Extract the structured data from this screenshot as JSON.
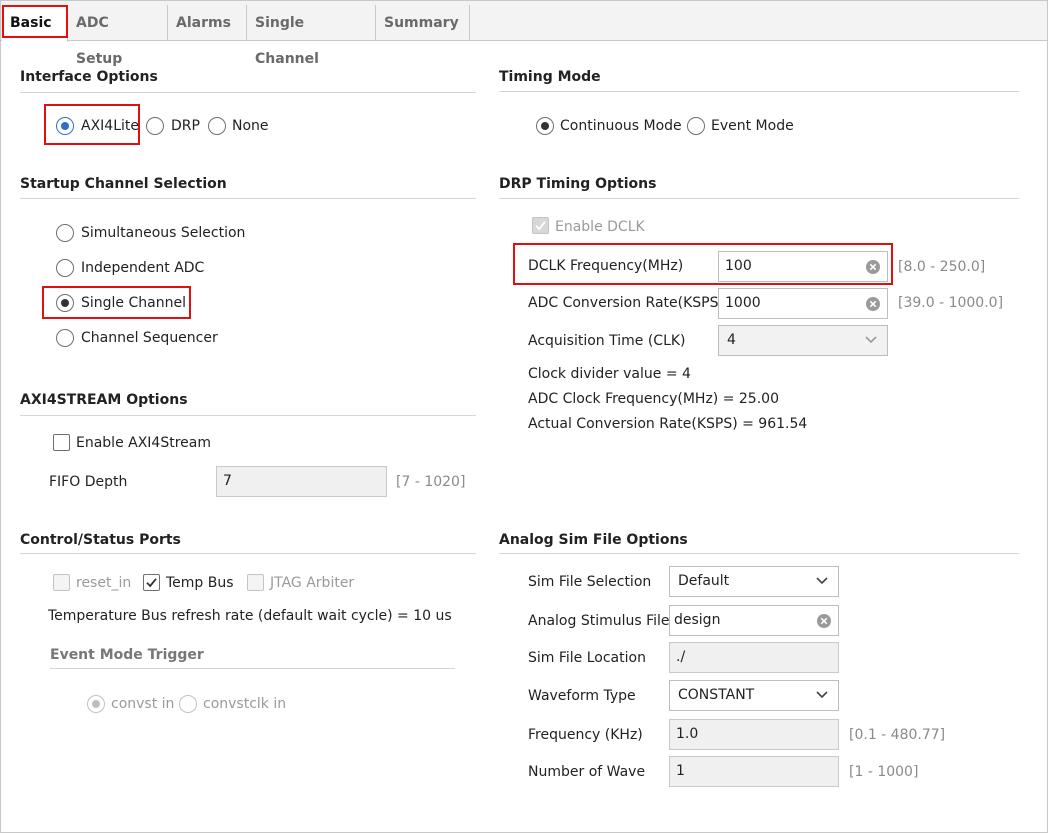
{
  "tabs": [
    {
      "label": "Basic",
      "active": true
    },
    {
      "label": "ADC Setup",
      "active": false
    },
    {
      "label": "Alarms",
      "active": false
    },
    {
      "label": "Single Channel",
      "active": false
    },
    {
      "label": "Summary",
      "active": false
    }
  ],
  "interface_options": {
    "title": "Interface Options",
    "options": [
      "AXI4Lite",
      "DRP",
      "None"
    ],
    "selected": "AXI4Lite"
  },
  "timing_mode": {
    "title": "Timing Mode",
    "options": [
      "Continuous Mode",
      "Event Mode"
    ],
    "selected": "Continuous Mode"
  },
  "startup_channel": {
    "title": "Startup Channel Selection",
    "options": [
      "Simultaneous Selection",
      "Independent ADC",
      "Single Channel",
      "Channel Sequencer"
    ],
    "selected": "Single Channel"
  },
  "drp_timing": {
    "title": "DRP Timing Options",
    "enable_dclk_label": "Enable DCLK",
    "enable_dclk_checked": true,
    "dclk_label": "DCLK Frequency(MHz)",
    "dclk_value": "100",
    "dclk_range": "[8.0 - 250.0]",
    "adc_rate_label": "ADC Conversion Rate(KSPS)",
    "adc_rate_value": "1000",
    "adc_rate_range": "[39.0 - 1000.0]",
    "acq_label": "Acquisition Time (CLK)",
    "acq_value": "4",
    "clock_divider": "Clock divider value = 4",
    "adc_clock_freq": "ADC Clock Frequency(MHz) = 25.00",
    "actual_rate": "Actual Conversion Rate(KSPS) = 961.54"
  },
  "axi4stream": {
    "title": "AXI4STREAM Options",
    "enable_label": "Enable AXI4Stream",
    "enable_checked": false,
    "fifo_label": "FIFO Depth",
    "fifo_value": "7",
    "fifo_range": "[7 - 1020]"
  },
  "control_status": {
    "title": "Control/Status Ports",
    "reset_label": "reset_in",
    "temp_bus_label": "Temp Bus",
    "jtag_label": "JTAG Arbiter",
    "temp_refresh": "Temperature Bus refresh rate (default wait cycle) = 10 us",
    "event_trigger_title": "Event Mode Trigger",
    "trigger_options": [
      "convst in",
      "convstclk in"
    ],
    "trigger_selected": "convst in"
  },
  "analog_sim": {
    "title": "Analog Sim File Options",
    "sim_file_label": "Sim File Selection",
    "sim_file_value": "Default",
    "stimulus_label": "Analog Stimulus File",
    "stimulus_value": "design",
    "location_label": "Sim File Location",
    "location_value": "./",
    "waveform_label": "Waveform Type",
    "waveform_value": "CONSTANT",
    "freq_label": "Frequency (KHz)",
    "freq_value": "1.0",
    "freq_range": "[0.1 - 480.77]",
    "waves_label": "Number of Wave",
    "waves_value": "1",
    "waves_range": "[1 - 1000]"
  },
  "colors": {
    "highlight": "#e01010",
    "radio_blue": "#2f6fd0"
  }
}
